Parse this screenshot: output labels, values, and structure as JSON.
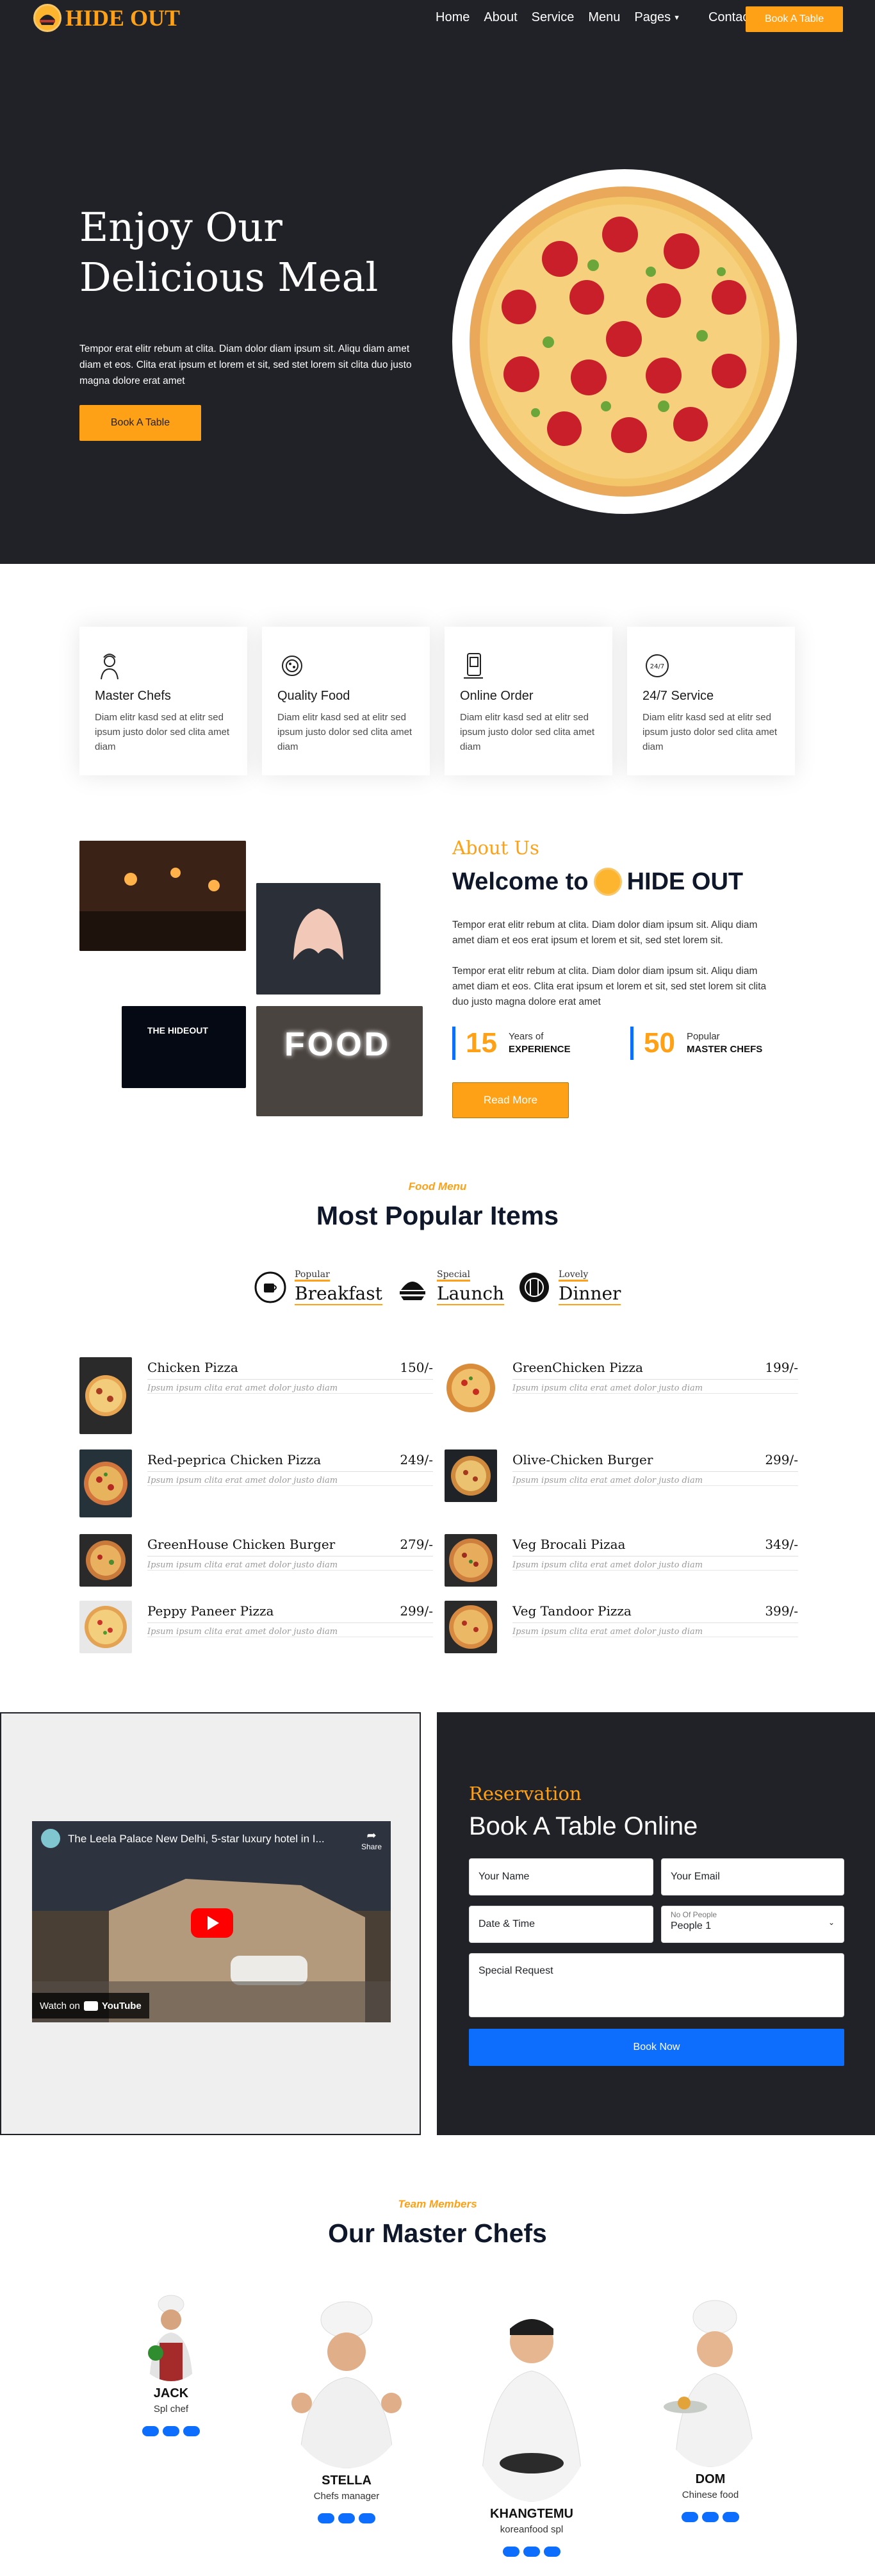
{
  "nav": {
    "logo_text": "HIDE OUT",
    "items": [
      "Home",
      "About",
      "Service",
      "Menu",
      "Pages",
      "Contact"
    ],
    "book_button": "Book A Table"
  },
  "hero": {
    "title_line1": "Enjoy Our",
    "title_line2": "Delicious Meal",
    "text": "Tempor erat elitr rebum at clita. Diam dolor diam ipsum sit. Aliqu diam amet diam et eos. Clita erat ipsum et lorem et sit, sed stet lorem sit clita duo justo magna dolore erat amet",
    "button": "Book A Table"
  },
  "services": [
    {
      "icon": "chef-icon",
      "title": "Master Chefs",
      "text": "Diam elitr kasd sed at elitr sed ipsum justo dolor sed clita amet diam"
    },
    {
      "icon": "food-icon",
      "title": "Quality Food",
      "text": "Diam elitr kasd sed at elitr sed ipsum justo dolor sed clita amet diam"
    },
    {
      "icon": "order-icon",
      "title": "Online Order",
      "text": "Diam elitr kasd sed at elitr sed ipsum justo dolor sed clita amet diam"
    },
    {
      "icon": "clock-icon",
      "title": "24/7 Service",
      "text": "Diam elitr kasd sed at elitr sed ipsum justo dolor sed clita amet diam"
    }
  ],
  "about": {
    "subtitle": "About Us",
    "title_prefix": "Welcome to",
    "title_brand": "HIDE OUT",
    "p1": "Tempor erat elitr rebum at clita. Diam dolor diam ipsum sit. Aliqu diam amet diam et eos erat ipsum et lorem et sit, sed stet lorem sit.",
    "p2": "Tempor erat elitr rebum at clita. Diam dolor diam ipsum sit. Aliqu diam amet diam et eos. Clita erat ipsum et lorem et sit, sed stet lorem sit clita duo justo magna dolore erat amet",
    "stat1": {
      "num": "15",
      "label1": "Years of",
      "label2": "EXPERIENCE"
    },
    "stat2": {
      "num": "50",
      "label1": "Popular",
      "label2": "MASTER CHEFS"
    },
    "button": "Read More",
    "sign_text": "THE HIDEOUT",
    "food_sign": "FOOD"
  },
  "menu": {
    "subtitle": "Food Menu",
    "title": "Most Popular Items",
    "tabs": [
      {
        "small": "Popular",
        "big": "Breakfast"
      },
      {
        "small": "Special",
        "big": "Launch"
      },
      {
        "small": "Lovely",
        "big": "Dinner"
      }
    ],
    "items": [
      {
        "name": "Chicken Pizza",
        "price": "150/-",
        "desc": "Ipsum ipsum clita erat amet dolor justo diam"
      },
      {
        "name": "GreenChicken Pizza",
        "price": "199/-",
        "desc": "Ipsum ipsum clita erat amet dolor justo diam"
      },
      {
        "name": "Red-peprica Chicken Pizza",
        "price": "249/-",
        "desc": "Ipsum ipsum clita erat amet dolor justo diam"
      },
      {
        "name": "Olive-Chicken Burger",
        "price": "299/-",
        "desc": "Ipsum ipsum clita erat amet dolor justo diam"
      },
      {
        "name": "GreenHouse Chicken Burger",
        "price": "279/-",
        "desc": "Ipsum ipsum clita erat amet dolor justo diam"
      },
      {
        "name": "Veg Brocali Pizaa",
        "price": "349/-",
        "desc": "Ipsum ipsum clita erat amet dolor justo diam"
      },
      {
        "name": "Peppy Paneer Pizza",
        "price": "299/-",
        "desc": "Ipsum ipsum clita erat amet dolor justo diam"
      },
      {
        "name": "Veg Tandoor Pizza",
        "price": "399/-",
        "desc": "Ipsum ipsum clita erat amet dolor justo diam"
      }
    ]
  },
  "video": {
    "title": "The Leela Palace New Delhi, 5-star luxury hotel in I...",
    "share": "Share",
    "watch_on": "Watch on",
    "youtube": "YouTube"
  },
  "reservation": {
    "subtitle": "Reservation",
    "title": "Book A Table Online",
    "name_placeholder": "Your Name",
    "email_placeholder": "Your Email",
    "datetime_placeholder": "Date & Time",
    "people_label": "No Of People",
    "people_value": "People 1",
    "request_placeholder": "Special Request",
    "button": "Book Now"
  },
  "team": {
    "subtitle": "Team Members",
    "title": "Our Master Chefs",
    "members": [
      {
        "name": "JACK",
        "role": "Spl chef"
      },
      {
        "name": "STELLA",
        "role": "Chefs manager"
      },
      {
        "name": "KHANGTEMU",
        "role": "koreanfood spl"
      },
      {
        "name": "DOM",
        "role": "Chinese food"
      }
    ]
  },
  "colors": {
    "accent": "#fea116",
    "dark": "#202227",
    "blue": "#0d6efd"
  }
}
